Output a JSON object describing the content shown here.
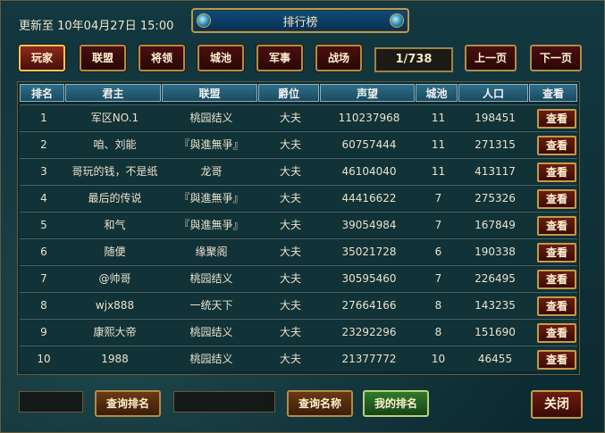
{
  "header": {
    "update_text": "更新至 10年04月27日 15:00",
    "title": "排行榜"
  },
  "tabs": [
    {
      "label": "玩家",
      "active": true
    },
    {
      "label": "联盟",
      "active": false
    },
    {
      "label": "将领",
      "active": false
    },
    {
      "label": "城池",
      "active": false
    },
    {
      "label": "军事",
      "active": false
    },
    {
      "label": "战场",
      "active": false
    }
  ],
  "pagination": {
    "page": "1/738",
    "prev_label": "上一页",
    "next_label": "下一页"
  },
  "table": {
    "columns": [
      "排名",
      "君主",
      "联盟",
      "爵位",
      "声望",
      "城池",
      "人口",
      "查看"
    ],
    "view_label": "查看",
    "rows": [
      [
        "1",
        "军区NO.1",
        "桃园结义",
        "大夫",
        "110237968",
        "11",
        "198451"
      ],
      [
        "2",
        "咱、刘能",
        "『與進無爭』",
        "大夫",
        "60757444",
        "11",
        "271315"
      ],
      [
        "3",
        "哥玩的钱，不是纸",
        "龙哥",
        "大夫",
        "46104040",
        "11",
        "413117"
      ],
      [
        "4",
        "最后的传说",
        "『與進無爭』",
        "大夫",
        "44416622",
        "7",
        "275326"
      ],
      [
        "5",
        "和气",
        "『與進無爭』",
        "大夫",
        "39054984",
        "7",
        "167849"
      ],
      [
        "6",
        "随便",
        "缘聚阁",
        "大夫",
        "35021728",
        "6",
        "190338"
      ],
      [
        "7",
        "@帅哥",
        "桃园结义",
        "大夫",
        "30595460",
        "7",
        "226495"
      ],
      [
        "8",
        "wjx888",
        "一统天下",
        "大夫",
        "27664166",
        "8",
        "143235"
      ],
      [
        "9",
        "康熙大帝",
        "桃园结义",
        "大夫",
        "23292296",
        "8",
        "151690"
      ],
      [
        "10",
        "1988",
        "桃园结义",
        "大夫",
        "21377772",
        "10",
        "46455"
      ]
    ]
  },
  "footer": {
    "rank_input_value": "",
    "query_rank_label": "查询排名",
    "name_input_value": "",
    "query_name_label": "查询名称",
    "my_rank_label": "我的排名",
    "close_label": "关闭"
  }
}
